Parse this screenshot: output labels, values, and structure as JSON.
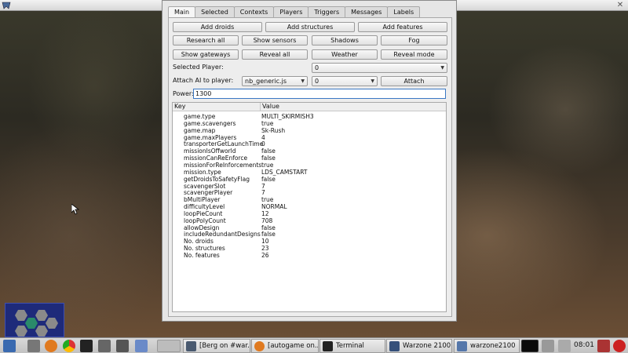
{
  "dialog": {
    "tabs": [
      {
        "label": "Main",
        "active": true
      },
      {
        "label": "Selected"
      },
      {
        "label": "Contexts"
      },
      {
        "label": "Players"
      },
      {
        "label": "Triggers"
      },
      {
        "label": "Messages"
      },
      {
        "label": "Labels"
      }
    ],
    "buttons": {
      "add_droids": "Add droids",
      "add_structures": "Add structures",
      "add_features": "Add features",
      "research_all": "Research all",
      "show_sensors": "Show sensors",
      "shadows": "Shadows",
      "fog": "Fog",
      "show_gateways": "Show gateways",
      "reveal_all": "Reveal all",
      "weather": "Weather",
      "reveal_mode": "Reveal mode",
      "attach": "Attach"
    },
    "selected_player": {
      "label": "Selected Player:",
      "value": "0"
    },
    "attach_ai": {
      "label": "Attach AI to player:",
      "script": "nb_generic.js",
      "player": "0"
    },
    "power": {
      "label": "Power:",
      "value": "1300"
    },
    "table": {
      "headers": {
        "key": "Key",
        "value": "Value"
      },
      "rows": [
        {
          "key": "game.type",
          "value": "MULTI_SKIRMISH3"
        },
        {
          "key": "game.scavengers",
          "value": "true"
        },
        {
          "key": "game.map",
          "value": "Sk-Rush"
        },
        {
          "key": "game.maxPlayers",
          "value": "4"
        },
        {
          "key": "transporterGetLaunchTime",
          "value": "0"
        },
        {
          "key": "missionIsOffworld",
          "value": "false"
        },
        {
          "key": "missionCanReEnforce",
          "value": "false"
        },
        {
          "key": "missionForReInforcements",
          "value": "true"
        },
        {
          "key": "mission.type",
          "value": "LDS_CAMSTART"
        },
        {
          "key": "getDroidsToSafetyFlag",
          "value": "false"
        },
        {
          "key": "scavengerSlot",
          "value": "7"
        },
        {
          "key": "scavengerPlayer",
          "value": "7"
        },
        {
          "key": "bMultiPlayer",
          "value": "true"
        },
        {
          "key": "difficultyLevel",
          "value": "NORMAL"
        },
        {
          "key": "loopPieCount",
          "value": "12"
        },
        {
          "key": "loopPolyCount",
          "value": "708"
        },
        {
          "key": "allowDesign",
          "value": "false"
        },
        {
          "key": "includeRedundantDesigns",
          "value": "false"
        },
        {
          "key": "No. droids",
          "value": "10"
        },
        {
          "key": "No. structures",
          "value": "23"
        },
        {
          "key": "No. features",
          "value": "26"
        }
      ]
    }
  },
  "taskbar": {
    "tasks": [
      {
        "label": "[Berg on #war...",
        "icon": "chat-icon",
        "color": "#4a5a70"
      },
      {
        "label": "[autogame on...",
        "icon": "firefox-icon",
        "color": "#e07a20"
      },
      {
        "label": "Terminal",
        "icon": "terminal-icon",
        "color": "#222222"
      },
      {
        "label": "Warzone 2100",
        "icon": "warzone-icon",
        "color": "#35507a"
      },
      {
        "label": "warzone2100",
        "icon": "window-icon",
        "color": "#5577aa"
      }
    ],
    "clock": "08:01"
  }
}
